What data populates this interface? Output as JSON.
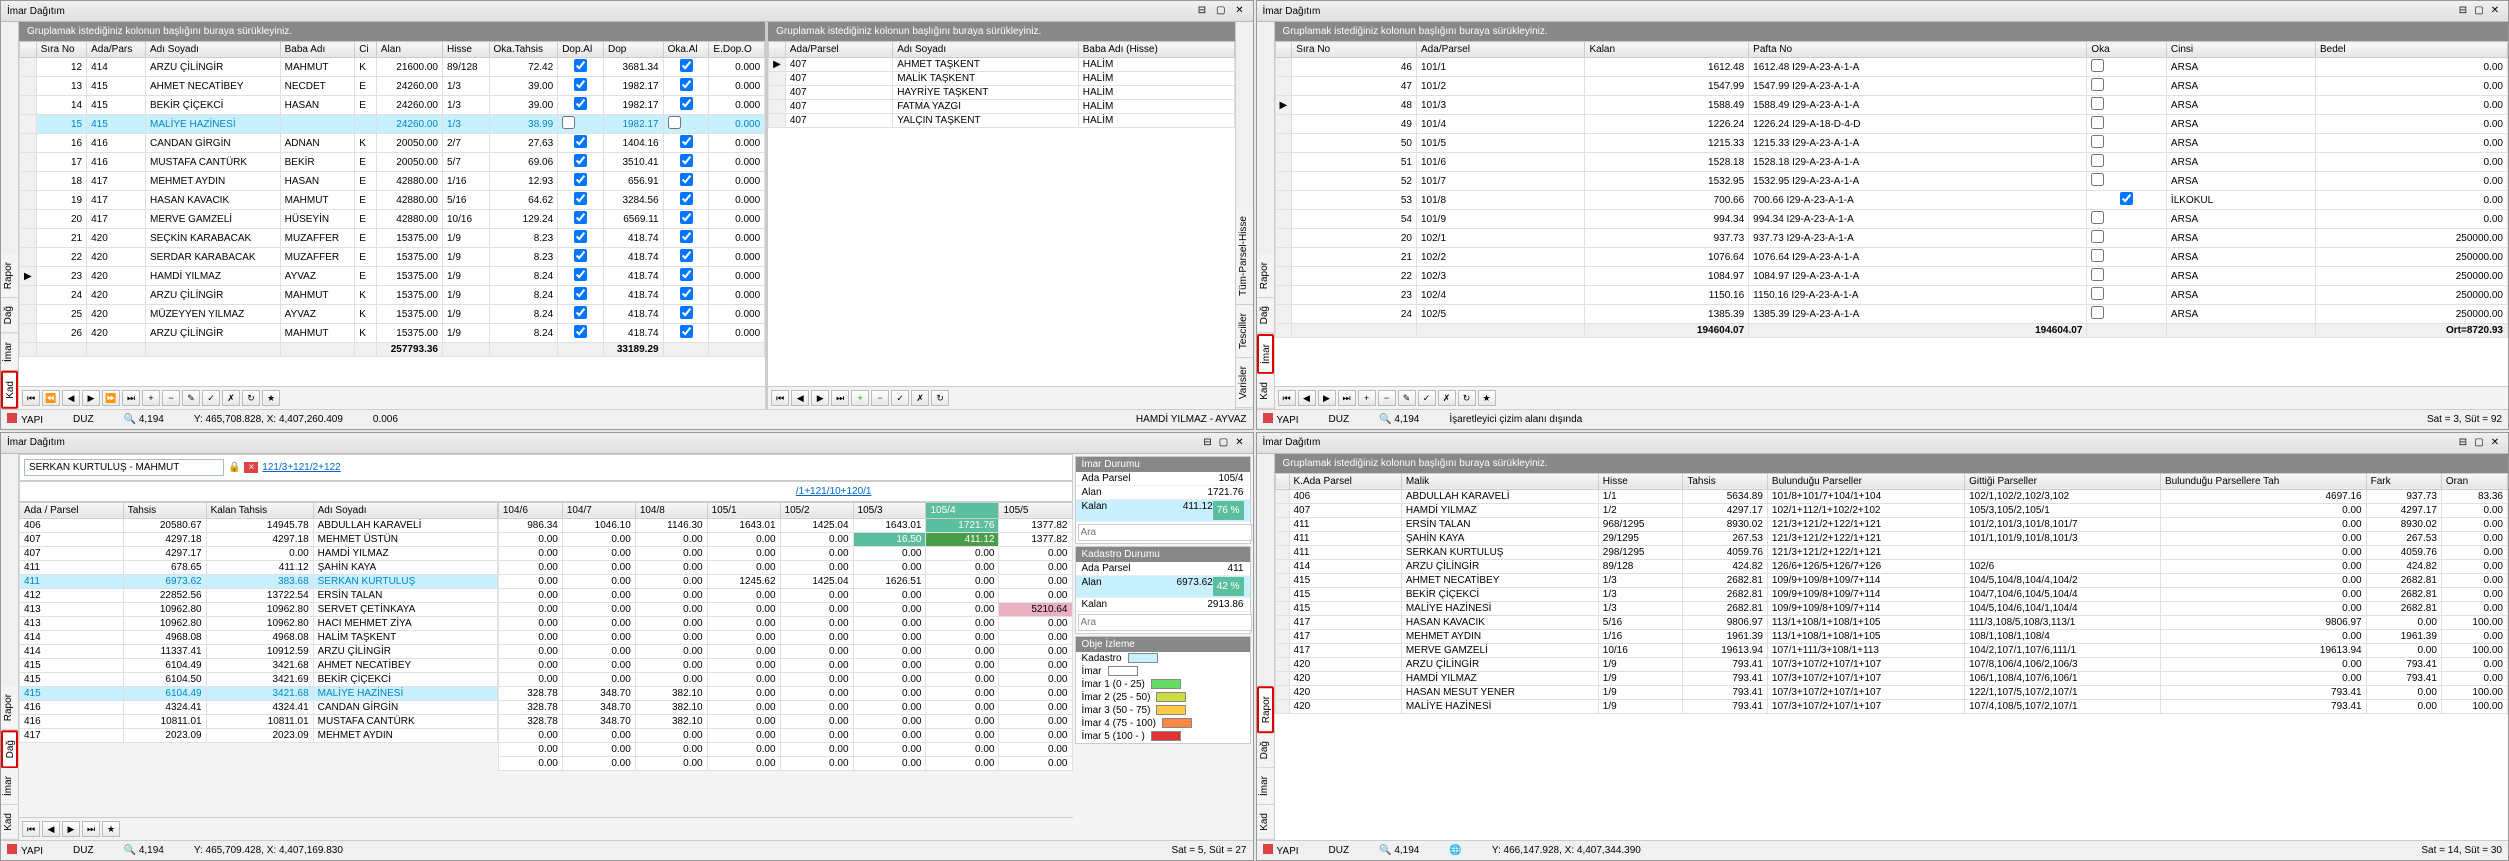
{
  "title": "İmar Dağıtım",
  "group_hint": "Gruplamak istediğiniz kolonun başlığını buraya sürükleyiniz.",
  "status": {
    "yapi": "YAPI",
    "duz": "DUZ",
    "scale": "4,194",
    "coord1": "Y: 465,708.828, X: 4,407,260.409",
    "extra1": "0.006",
    "user": "HAMDİ YILMAZ - AYVAZ",
    "coord2": "İşaretleyici çizim alanı dışında",
    "sat2": "Sat = 3, Süt = 92",
    "coord3": "Y: 465,709.428, X: 4,407,169.830",
    "sat3": "Sat = 5, Süt = 27",
    "coord4": "Y: 466,147.928, X: 4,407,344.390",
    "sat4": "Sat = 14, Süt = 30"
  },
  "q1": {
    "cols": [
      "Sıra No",
      "Ada/Pars",
      "Adı Soyadı",
      "Baba Adı",
      "Ci",
      "Alan",
      "Hisse",
      "Oka.Tahsis",
      "Dop.Al",
      "Dop",
      "Oka.Al",
      "E.Dop.O"
    ],
    "rows": [
      [
        "12",
        "414",
        "ARZU ÇİLİNGİR",
        "MAHMUT",
        "K",
        "21600.00",
        "89/128",
        "72.42",
        "✓",
        "3681.34",
        "✓",
        "0.000"
      ],
      [
        "13",
        "415",
        "AHMET NECATİBEY",
        "NECDET",
        "E",
        "24260.00",
        "1/3",
        "39.00",
        "✓",
        "1982.17",
        "✓",
        "0.000"
      ],
      [
        "14",
        "415",
        "BEKİR ÇİÇEKCİ",
        "HASAN",
        "E",
        "24260.00",
        "1/3",
        "39.00",
        "✓",
        "1982.17",
        "✓",
        "0.000"
      ],
      [
        "15",
        "415",
        "MALİYE HAZİNESİ",
        "",
        "",
        "24260.00",
        "1/3",
        "38.99",
        "",
        "1982.17",
        "",
        "0.000"
      ],
      [
        "16",
        "416",
        "CANDAN GİRGİN",
        "ADNAN",
        "K",
        "20050.00",
        "2/7",
        "27.63",
        "✓",
        "1404.16",
        "✓",
        "0.000"
      ],
      [
        "17",
        "416",
        "MUSTAFA CANTÜRK",
        "BEKİR",
        "E",
        "20050.00",
        "5/7",
        "69.06",
        "✓",
        "3510.41",
        "✓",
        "0.000"
      ],
      [
        "18",
        "417",
        "MEHMET AYDIN",
        "HASAN",
        "E",
        "42880.00",
        "1/16",
        "12.93",
        "✓",
        "656.91",
        "✓",
        "0.000"
      ],
      [
        "19",
        "417",
        "HASAN KAVACIK",
        "MAHMUT",
        "E",
        "42880.00",
        "5/16",
        "64.62",
        "✓",
        "3284.56",
        "✓",
        "0.000"
      ],
      [
        "20",
        "417",
        "MERVE GAMZELİ",
        "HÜSEYİN",
        "E",
        "42880.00",
        "10/16",
        "129.24",
        "✓",
        "6569.11",
        "✓",
        "0.000"
      ],
      [
        "21",
        "420",
        "SEÇKİN KARABACAK",
        "MUZAFFER",
        "E",
        "15375.00",
        "1/9",
        "8.23",
        "✓",
        "418.74",
        "✓",
        "0.000"
      ],
      [
        "22",
        "420",
        "SERDAR KARABACAK",
        "MUZAFFER",
        "E",
        "15375.00",
        "1/9",
        "8.23",
        "✓",
        "418.74",
        "✓",
        "0.000"
      ],
      [
        "23",
        "420",
        "HAMDİ YILMAZ",
        "AYVAZ",
        "E",
        "15375.00",
        "1/9",
        "8.24",
        "✓",
        "418.74",
        "✓",
        "0.000"
      ],
      [
        "24",
        "420",
        "ARZU ÇİLİNGİR",
        "MAHMUT",
        "K",
        "15375.00",
        "1/9",
        "8.24",
        "✓",
        "418.74",
        "✓",
        "0.000"
      ],
      [
        "25",
        "420",
        "MÜZEYYEN YILMAZ",
        "AYVAZ",
        "K",
        "15375.00",
        "1/9",
        "8.24",
        "✓",
        "418.74",
        "✓",
        "0.000"
      ],
      [
        "26",
        "420",
        "ARZU ÇİLİNGİR",
        "MAHMUT",
        "K",
        "15375.00",
        "1/9",
        "8.24",
        "✓",
        "418.74",
        "✓",
        "0.000"
      ]
    ],
    "sum1": "257793.36",
    "sum2": "33189.29",
    "right_cols": [
      "Ada/Parsel",
      "Adı Soyadı",
      "Baba Adı (Hisse)"
    ],
    "right_rows": [
      [
        "407",
        "AHMET TAŞKENT",
        "HALİM"
      ],
      [
        "407",
        "MALİK TAŞKENT",
        "HALİM"
      ],
      [
        "407",
        "HAYRİYE TAŞKENT",
        "HALİM"
      ],
      [
        "407",
        "FATMA YAZGI",
        "HALİM"
      ],
      [
        "407",
        "YALÇIN TAŞKENT",
        "HALİM"
      ]
    ],
    "tabs_l": [
      "Rapor",
      "Dağ",
      "İmar",
      "Kad"
    ],
    "tabs_r": [
      "Tüm-Parsel-Hisse",
      "Tesciller",
      "Varisler"
    ]
  },
  "q2": {
    "cols": [
      "Sıra No",
      "Ada/Parsel",
      "Kalan",
      "Pafta No",
      "Oka",
      "Cinsi",
      "Bedel"
    ],
    "rows": [
      [
        "46",
        "101/1",
        "1612.48",
        "1612.48 I29-A-23-A-1-A",
        "",
        "ARSA",
        "0.00"
      ],
      [
        "47",
        "101/2",
        "1547.99",
        "1547.99 I29-A-23-A-1-A",
        "",
        "ARSA",
        "0.00"
      ],
      [
        "48",
        "101/3",
        "1588.49",
        "1588.49 I29-A-23-A-1-A",
        "",
        "ARSA",
        "0.00"
      ],
      [
        "49",
        "101/4",
        "1226.24",
        "1226.24 I29-A-18-D-4-D",
        "",
        "ARSA",
        "0.00"
      ],
      [
        "50",
        "101/5",
        "1215.33",
        "1215.33 I29-A-23-A-1-A",
        "",
        "ARSA",
        "0.00"
      ],
      [
        "51",
        "101/6",
        "1528.18",
        "1528.18 I29-A-23-A-1-A",
        "",
        "ARSA",
        "0.00"
      ],
      [
        "52",
        "101/7",
        "1532.95",
        "1532.95 I29-A-23-A-1-A",
        "",
        "ARSA",
        "0.00"
      ],
      [
        "53",
        "101/8",
        "700.66",
        "700.66 I29-A-23-A-1-A",
        "✓",
        "İLKOKUL",
        "0.00"
      ],
      [
        "54",
        "101/9",
        "994.34",
        "994.34 I29-A-23-A-1-A",
        "",
        "ARSA",
        "0.00"
      ],
      [
        "20",
        "102/1",
        "937.73",
        "937.73 I29-A-23-A-1-A",
        "",
        "ARSA",
        "250000.00"
      ],
      [
        "21",
        "102/2",
        "1076.64",
        "1076.64 I29-A-23-A-1-A",
        "",
        "ARSA",
        "250000.00"
      ],
      [
        "22",
        "102/3",
        "1084.97",
        "1084.97 I29-A-23-A-1-A",
        "",
        "ARSA",
        "250000.00"
      ],
      [
        "23",
        "102/4",
        "1150.16",
        "1150.16 I29-A-23-A-1-A",
        "",
        "ARSA",
        "250000.00"
      ],
      [
        "24",
        "102/5",
        "1385.39",
        "1385.39 I29-A-23-A-1-A",
        "",
        "ARSA",
        "250000.00"
      ]
    ],
    "sum1": "194604.07",
    "sum2": "194604.07",
    "sum3": "Ort=8720.93",
    "tabs": [
      "Rapor",
      "Dağ",
      "İmar",
      "Kad"
    ]
  },
  "q3": {
    "owner": "SERKAN KURTULUŞ - MAHMUT",
    "links": [
      "121/3+121/2+122",
      "/1+121/10+120/1"
    ],
    "hdr_cols": [
      "104/6",
      "104/7",
      "104/8",
      "105/1",
      "105/2",
      "105/3",
      "105/4",
      "105/5"
    ],
    "hdr_r1": [
      "986.34",
      "1046.10",
      "1146.30",
      "1643.01",
      "1425.04",
      "1643.01",
      "1721.76",
      "1377.82"
    ],
    "hdr_r2": [
      "0.00",
      "0.00",
      "0.00",
      "0.00",
      "0.00",
      "16.50",
      "411.12",
      "1377.82"
    ],
    "hdr_r3": [
      "0.00",
      "0.00",
      "0.00",
      "",
      "",
      "",
      "",
      "0.00"
    ],
    "cols": [
      "Ada / Parsel",
      "Tahsis",
      "Kalan Tahsis",
      "Adı Soyadı"
    ],
    "rows": [
      [
        "406",
        "20580.67",
        "14945.78",
        "ABDULLAH KARAVELİ"
      ],
      [
        "407",
        "4297.18",
        "4297.18",
        "MEHMET ÜSTÜN"
      ],
      [
        "407",
        "4297.17",
        "0.00",
        "HAMDİ YILMAZ"
      ],
      [
        "411",
        "678.65",
        "411.12",
        "ŞAHİN KAYA"
      ],
      [
        "411",
        "6973.62",
        "383.68",
        "SERKAN KURTULUŞ"
      ],
      [
        "412",
        "22852.56",
        "13722.54",
        "ERSİN TALAN"
      ],
      [
        "413",
        "10962.80",
        "10962.80",
        "SERVET ÇETİNKAYA"
      ],
      [
        "413",
        "10962.80",
        "10962.80",
        "HACI MEHMET ZİYA"
      ],
      [
        "414",
        "4968.08",
        "4968.08",
        "HALİM TAŞKENT"
      ],
      [
        "414",
        "11337.41",
        "10912.59",
        "ARZU ÇİLİNGİR"
      ],
      [
        "415",
        "6104.49",
        "3421.68",
        "AHMET NECATİBEY"
      ],
      [
        "415",
        "6104.50",
        "3421.69",
        "BEKİR ÇİÇEKCİ"
      ],
      [
        "415",
        "6104.49",
        "3421.68",
        "MALİYE HAZİNESİ"
      ],
      [
        "416",
        "4324.41",
        "4324.41",
        "CANDAN GİRGİN"
      ],
      [
        "416",
        "10811.01",
        "10811.01",
        "MUSTAFA CANTÜRK"
      ],
      [
        "417",
        "2023.09",
        "2023.09",
        "MEHMET AYDIN"
      ]
    ],
    "matrix": [
      [
        "0.00",
        "0.00",
        "0.00",
        "0.00",
        "0.00",
        "0.00",
        "0.00",
        "0.00"
      ],
      [
        "0.00",
        "0.00",
        "0.00",
        "0.00",
        "0.00",
        "0.00",
        "0.00",
        "0.00"
      ],
      [
        "0.00",
        "0.00",
        "0.00",
        "1245.62",
        "1425.04",
        "1626.51",
        "0.00",
        "0.00"
      ],
      [
        "0.00",
        "0.00",
        "0.00",
        "0.00",
        "0.00",
        "0.00",
        "0.00",
        "0.00"
      ],
      [
        "0.00",
        "0.00",
        "0.00",
        "0.00",
        "0.00",
        "0.00",
        "0.00",
        "5210.64"
      ],
      [
        "0.00",
        "0.00",
        "0.00",
        "0.00",
        "0.00",
        "0.00",
        "0.00",
        "0.00"
      ],
      [
        "0.00",
        "0.00",
        "0.00",
        "0.00",
        "0.00",
        "0.00",
        "0.00",
        "0.00"
      ],
      [
        "0.00",
        "0.00",
        "0.00",
        "0.00",
        "0.00",
        "0.00",
        "0.00",
        "0.00"
      ],
      [
        "0.00",
        "0.00",
        "0.00",
        "0.00",
        "0.00",
        "0.00",
        "0.00",
        "0.00"
      ],
      [
        "0.00",
        "0.00",
        "0.00",
        "0.00",
        "0.00",
        "0.00",
        "0.00",
        "0.00"
      ],
      [
        "328.78",
        "348.70",
        "382.10",
        "0.00",
        "0.00",
        "0.00",
        "0.00",
        "0.00"
      ],
      [
        "328.78",
        "348.70",
        "382.10",
        "0.00",
        "0.00",
        "0.00",
        "0.00",
        "0.00"
      ],
      [
        "328.78",
        "348.70",
        "382.10",
        "0.00",
        "0.00",
        "0.00",
        "0.00",
        "0.00"
      ],
      [
        "0.00",
        "0.00",
        "0.00",
        "0.00",
        "0.00",
        "0.00",
        "0.00",
        "0.00"
      ],
      [
        "0.00",
        "0.00",
        "0.00",
        "0.00",
        "0.00",
        "0.00",
        "0.00",
        "0.00"
      ],
      [
        "0.00",
        "0.00",
        "0.00",
        "0.00",
        "0.00",
        "0.00",
        "0.00",
        "0.00"
      ]
    ],
    "imar_durumu": {
      "hdr": "İmar Durumu",
      "ada": "Ada Parsel",
      "ada_v": "105/4",
      "alan": "Alan",
      "alan_v": "1721.76",
      "kalan": "Kalan",
      "kalan_v": "411.12",
      "pct": "76 %"
    },
    "kad_durumu": {
      "hdr": "Kadastro  Durumu",
      "ada": "Ada Parsel",
      "ada_v": "411",
      "alan": "Alan",
      "alan_v": "6973.62",
      "kalan": "Kalan",
      "kalan_v": "2913.86",
      "pct": "42 %"
    },
    "obje": {
      "hdr": "Obje İzleme",
      "items": [
        "Kadastro",
        "İmar",
        "İmar 1 (0 - 25)",
        "İmar 2 (25 - 50)",
        "İmar 3 (50 - 75)",
        "İmar 4 (75 - 100)",
        "İmar 5 (100 - )"
      ],
      "colors": [
        "#c8f0ff",
        "#ffffff",
        "#66dd66",
        "#ccdd44",
        "#ffcc44",
        "#ff8844",
        "#dd3333"
      ]
    },
    "search": "Ara",
    "tabs": [
      "Rapor",
      "Dağ",
      "İmar",
      "Kad"
    ]
  },
  "q4": {
    "cols": [
      "K.Ada Parsel",
      "Malik",
      "Hisse",
      "Tahsis",
      "Bulunduğu Parseller",
      "Gittiği Parseller",
      "Bulunduğu Parsellere Tah",
      "Fark",
      "Oran"
    ],
    "rows": [
      [
        "406",
        "ABDULLAH KARAVELİ",
        "1/1",
        "5634.89",
        "101/8+101/7+104/1+104",
        "102/1,102/2,102/3,102",
        "4697.16",
        "937.73",
        "83.36"
      ],
      [
        "407",
        "HAMDİ YILMAZ",
        "1/2",
        "4297.17",
        "102/1+112/1+102/2+102",
        "105/3,105/2,105/1",
        "0.00",
        "4297.17",
        "0.00"
      ],
      [
        "411",
        "ERSİN TALAN",
        "968/1295",
        "8930.02",
        "121/3+121/2+122/1+121",
        "101/2,101/3,101/8,101/7",
        "0.00",
        "8930.02",
        "0.00"
      ],
      [
        "411",
        "ŞAHİN KAYA",
        "29/1295",
        "267.53",
        "121/3+121/2+122/1+121",
        "101/1,101/9,101/8,101/3",
        "0.00",
        "267.53",
        "0.00"
      ],
      [
        "411",
        "SERKAN KURTULUŞ",
        "298/1295",
        "4059.76",
        "121/3+121/2+122/1+121",
        "",
        "0.00",
        "4059.76",
        "0.00"
      ],
      [
        "414",
        "ARZU ÇİLİNGİR",
        "89/128",
        "424.82",
        "126/6+126/5+126/7+126",
        "102/6",
        "0.00",
        "424.82",
        "0.00"
      ],
      [
        "415",
        "AHMET NECATİBEY",
        "1/3",
        "2682.81",
        "109/9+109/8+109/7+114",
        "104/5,104/8,104/4,104/2",
        "0.00",
        "2682.81",
        "0.00"
      ],
      [
        "415",
        "BEKİR ÇİÇEKCİ",
        "1/3",
        "2682.81",
        "109/9+109/8+109/7+114",
        "104/7,104/6,104/5,104/4",
        "0.00",
        "2682.81",
        "0.00"
      ],
      [
        "415",
        "MALİYE HAZİNESİ",
        "1/3",
        "2682.81",
        "109/9+109/8+109/7+114",
        "104/5,104/6,104/1,104/4",
        "0.00",
        "2682.81",
        "0.00"
      ],
      [
        "417",
        "HASAN KAVACIK",
        "5/16",
        "9806.97",
        "113/1+108/1+108/1+105",
        "111/3,108/5,108/3,113/1",
        "9806.97",
        "0.00",
        "100.00"
      ],
      [
        "417",
        "MEHMET AYDIN",
        "1/16",
        "1961.39",
        "113/1+108/1+108/1+105",
        "108/1,108/1,108/4",
        "0.00",
        "1961.39",
        "0.00"
      ],
      [
        "417",
        "MERVE GAMZELİ",
        "10/16",
        "19613.94",
        "107/1+111/3+108/1+113",
        "104/2,107/1,107/6,111/1",
        "19613.94",
        "0.00",
        "100.00"
      ],
      [
        "420",
        "ARZU ÇİLİNGİR",
        "1/9",
        "793.41",
        "107/3+107/2+107/1+107",
        "107/8,106/4,106/2,106/3",
        "0.00",
        "793.41",
        "0.00"
      ],
      [
        "420",
        "HAMDİ YILMAZ",
        "1/9",
        "793.41",
        "107/3+107/2+107/1+107",
        "106/1,108/4,107/6,106/1",
        "0.00",
        "793.41",
        "0.00"
      ],
      [
        "420",
        "HASAN MESUT YENER",
        "1/9",
        "793.41",
        "107/3+107/2+107/1+107",
        "122/1,107/5,107/2,107/1",
        "793.41",
        "0.00",
        "100.00"
      ],
      [
        "420",
        "MALİYE HAZİNESİ",
        "1/9",
        "793.41",
        "107/3+107/2+107/1+107",
        "107/4,108/5,107/2,107/1",
        "793.41",
        "0.00",
        "100.00"
      ]
    ],
    "tabs": [
      "Rapor",
      "Dağ",
      "İmar",
      "Kad"
    ]
  }
}
